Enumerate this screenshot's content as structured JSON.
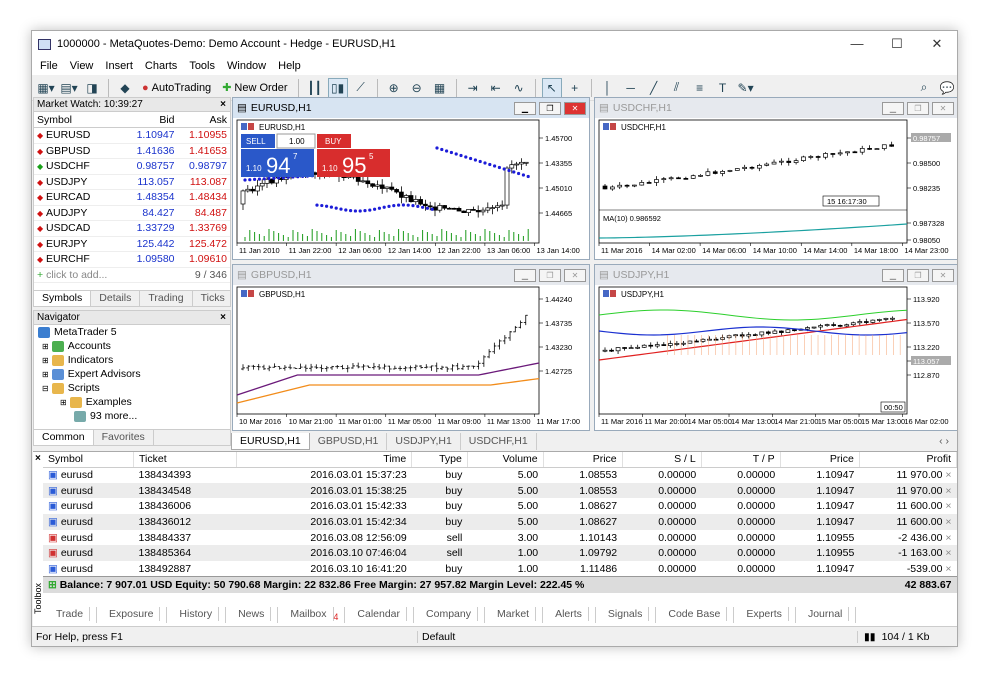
{
  "title": "1000000 - MetaQuotes-Demo: Demo Account - Hedge - EURUSD,H1",
  "menu": [
    "File",
    "View",
    "Insert",
    "Charts",
    "Tools",
    "Window",
    "Help"
  ],
  "toolbar": {
    "autotrading": "AutoTrading",
    "neworder": "New Order"
  },
  "market_watch": {
    "header": "Market Watch: 10:39:27",
    "cols": [
      "Symbol",
      "Bid",
      "Ask"
    ],
    "rows": [
      {
        "s": "EURUSD",
        "bid": "1.10947",
        "ask": "1.10955",
        "dir": "dn"
      },
      {
        "s": "GBPUSD",
        "bid": "1.41636",
        "ask": "1.41653",
        "dir": "dn"
      },
      {
        "s": "USDCHF",
        "bid": "0.98757",
        "ask": "0.98797",
        "dir": "up"
      },
      {
        "s": "USDJPY",
        "bid": "113.057",
        "ask": "113.087",
        "dir": "dn"
      },
      {
        "s": "EURCAD",
        "bid": "1.48354",
        "ask": "1.48434",
        "dir": "dn"
      },
      {
        "s": "AUDJPY",
        "bid": "84.427",
        "ask": "84.487",
        "dir": "dn"
      },
      {
        "s": "USDCAD",
        "bid": "1.33729",
        "ask": "1.33769",
        "dir": "dn"
      },
      {
        "s": "EURJPY",
        "bid": "125.442",
        "ask": "125.472",
        "dir": "dn"
      },
      {
        "s": "EURCHF",
        "bid": "1.09580",
        "ask": "1.09610",
        "dir": "dn"
      }
    ],
    "add": "click to add...",
    "count": "9 / 346",
    "tabs": [
      "Symbols",
      "Details",
      "Trading",
      "Ticks"
    ]
  },
  "navigator": {
    "header": "Navigator",
    "items": [
      "MetaTrader 5",
      "Accounts",
      "Indicators",
      "Expert Advisors",
      "Scripts",
      "Examples",
      "93 more..."
    ],
    "tabs": [
      "Common",
      "Favorites"
    ]
  },
  "charts": {
    "eurusd": {
      "title": "EURUSD,H1",
      "label": "EURUSD,H1",
      "sell": "SELL",
      "buy": "BUY",
      "lot": "1.00",
      "sell_big": "94",
      "sell_sup": "7",
      "sell_pre": "1.10",
      "buy_big": "95",
      "buy_sup": "5",
      "buy_pre": "1.10",
      "prices": [
        "1.45700",
        "1.43355",
        "1.45010",
        "1.44665"
      ],
      "times": [
        "11 Jan 2010",
        "11 Jan 22:00",
        "12 Jan 06:00",
        "12 Jan 14:00",
        "12 Jan 22:00",
        "13 Jan 06:00",
        "13 Jan 14:00"
      ]
    },
    "usdchf": {
      "title": "USDCHF,H1",
      "label": "USDCHF,H1",
      "prices": [
        "0.98757",
        "0.98500",
        "0.98235",
        "0.987328",
        "0.98050"
      ],
      "ma": "MA(10) 0.986592",
      "times": [
        "11 Mar 2016",
        "14 Mar 02:00",
        "14 Mar 06:00",
        "14 Mar 10:00",
        "14 Mar 14:00",
        "14 Mar 18:00",
        "14 Mar 23:00"
      ],
      "cursor": "15 16:17:30"
    },
    "gbpusd": {
      "title": "GBPUSD,H1",
      "label": "GBPUSD,H1",
      "prices": [
        "1.44240",
        "1.43735",
        "1.43230",
        "1.42725"
      ],
      "times": [
        "10 Mar 2016",
        "10 Mar 21:00",
        "11 Mar 01:00",
        "11 Mar 05:00",
        "11 Mar 09:00",
        "11 Mar 13:00",
        "11 Mar 17:00"
      ]
    },
    "usdjpy": {
      "title": "USDJPY,H1",
      "label": "USDJPY,H1",
      "prices": [
        "113.920",
        "113.570",
        "113.220",
        "113.057",
        "112.870"
      ],
      "times": [
        "11 Mar 2016",
        "11 Mar 20:00",
        "14 Mar 05:00",
        "14 Mar 13:00",
        "14 Mar 21:00",
        "15 Mar 05:00",
        "15 Mar 13:00",
        "16 Mar 02:00"
      ],
      "cursor": "00:50"
    }
  },
  "chart_tabs": [
    "EURUSD,H1",
    "GBPUSD,H1",
    "USDJPY,H1",
    "USDCHF,H1"
  ],
  "trade": {
    "cols": [
      "Symbol",
      "Ticket",
      "Time",
      "Type",
      "Volume",
      "Price",
      "S / L",
      "T / P",
      "Price",
      "Profit"
    ],
    "rows": [
      [
        "eurusd",
        "138434393",
        "2016.03.01 15:37:23",
        "buy",
        "5.00",
        "1.08553",
        "0.00000",
        "0.00000",
        "1.10947",
        "11 970.00"
      ],
      [
        "eurusd",
        "138434548",
        "2016.03.01 15:38:25",
        "buy",
        "5.00",
        "1.08553",
        "0.00000",
        "0.00000",
        "1.10947",
        "11 970.00"
      ],
      [
        "eurusd",
        "138436006",
        "2016.03.01 15:42:33",
        "buy",
        "5.00",
        "1.08627",
        "0.00000",
        "0.00000",
        "1.10947",
        "11 600.00"
      ],
      [
        "eurusd",
        "138436012",
        "2016.03.01 15:42:34",
        "buy",
        "5.00",
        "1.08627",
        "0.00000",
        "0.00000",
        "1.10947",
        "11 600.00"
      ],
      [
        "eurusd",
        "138484337",
        "2016.03.08 12:56:09",
        "sell",
        "3.00",
        "1.10143",
        "0.00000",
        "0.00000",
        "1.10955",
        "-2 436.00"
      ],
      [
        "eurusd",
        "138485364",
        "2016.03.10 07:46:04",
        "sell",
        "1.00",
        "1.09792",
        "0.00000",
        "0.00000",
        "1.10955",
        "-1 163.00"
      ],
      [
        "eurusd",
        "138492887",
        "2016.03.10 16:41:20",
        "buy",
        "1.00",
        "1.11486",
        "0.00000",
        "0.00000",
        "1.10947",
        "-539.00"
      ]
    ],
    "balance": "Balance: 7 907.01 USD  Equity: 50 790.68  Margin: 22 832.86  Free Margin: 27 957.82  Margin Level: 222.45 %",
    "total": "42 883.67"
  },
  "bottom_tabs": [
    "Trade",
    "Exposure",
    "History",
    "News",
    "Mailbox",
    "Calendar",
    "Company",
    "Market",
    "Alerts",
    "Signals",
    "Code Base",
    "Experts",
    "Journal"
  ],
  "mailbox_badge": "4",
  "toolbox_label": "Toolbox",
  "status": {
    "help": "For Help, press F1",
    "profile": "Default",
    "traffic": "104 / 1 Kb"
  }
}
